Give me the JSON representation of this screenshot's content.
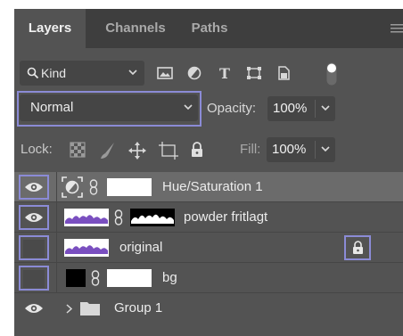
{
  "tabs": [
    {
      "label": "Layers",
      "active": true
    },
    {
      "label": "Channels",
      "active": false
    },
    {
      "label": "Paths",
      "active": false
    }
  ],
  "filter": {
    "kind_label": "Kind",
    "icons": [
      "image-filter-icon",
      "adjustment-filter-icon",
      "type-filter-icon",
      "shape-filter-icon",
      "smart-object-filter-icon",
      "filter-toggle-icon"
    ]
  },
  "blend": {
    "mode": "Normal",
    "opacity_label": "Opacity:",
    "opacity_value": "100%"
  },
  "lock": {
    "label": "Lock:",
    "fill_label": "Fill:",
    "fill_value": "100%",
    "icons": [
      "lock-transparent-pixels-icon",
      "lock-image-pixels-icon",
      "lock-position-icon",
      "lock-artboard-icon",
      "lock-all-icon"
    ]
  },
  "layers": [
    {
      "name": "Hue/Saturation 1",
      "visible": true,
      "selected": true,
      "type": "adjustment"
    },
    {
      "name": "powder fritlagt",
      "visible": true,
      "selected": false,
      "type": "masked"
    },
    {
      "name": "original",
      "visible": false,
      "selected": false,
      "type": "locked"
    },
    {
      "name": "bg",
      "visible": false,
      "selected": false,
      "type": "masked"
    },
    {
      "name": "Group 1",
      "visible": true,
      "selected": false,
      "type": "group"
    }
  ],
  "colors": {
    "panel": "#535353",
    "tabbar": "#3e3e3e",
    "highlight": "#8b8bd6",
    "field": "#454545"
  }
}
